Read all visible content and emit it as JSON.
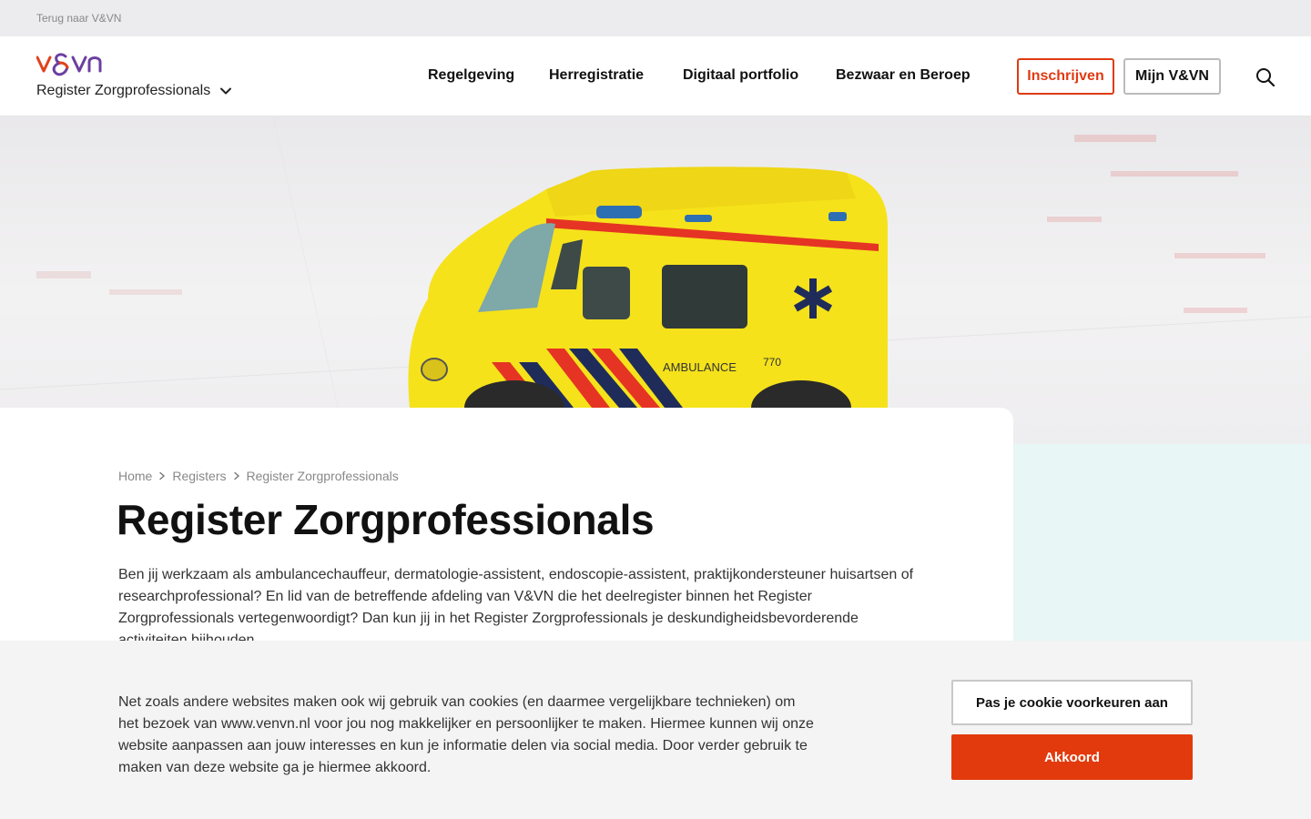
{
  "topbar": {
    "back_link": "Terug naar V&VN"
  },
  "header": {
    "logo": {
      "alt": "v&vn",
      "colors": {
        "v": "#e0421a",
        "ampersand": "#6b3fa0",
        "vn": "#6b3fa0"
      }
    },
    "site_selector": {
      "label": "Register Zorgprofessionals",
      "icon": "chevron-down-icon"
    },
    "nav": [
      {
        "label": "Regelgeving"
      },
      {
        "label": "Herregistratie"
      },
      {
        "label": "Digitaal portfolio"
      },
      {
        "label": "Bezwaar en Beroep"
      }
    ],
    "signup_label": "Inschrijven",
    "account_label": "Mijn V&VN",
    "search_icon": "search-icon"
  },
  "hero": {
    "image": "yellow toy ambulance",
    "vehicle_text": "AMBULANCE",
    "vehicle_number": "770"
  },
  "breadcrumb": [
    {
      "label": "Home"
    },
    {
      "label": "Registers"
    },
    {
      "label": "Register Zorgprofessionals"
    }
  ],
  "page": {
    "title": "Register Zorgprofessionals",
    "intro": "Ben jij werkzaam als ambulancechauffeur, dermatologie-assistent, endoscopie-assistent, praktijkondersteuner huisartsen of researchprofessional? En lid van de betreffende afdeling van V&VN die het deelregister binnen het Register Zorgprofessionals vertegenwoordigt? Dan kun jij in het Register Zorgprofessionals je deskundigheidsbevorderende activiteiten bijhouden."
  },
  "cookie": {
    "text": "Net zoals andere websites maken ook wij gebruik van cookies (en daarmee vergelijkbare technieken) om het bezoek van www.venvn.nl voor jou nog makkelijker en persoonlijker te maken. Hiermee kunnen wij onze website aanpassen aan jouw interesses en kun je informatie delen via social media. Door verder gebruik te maken van deze website ga je hiermee akkoord.",
    "preferences_label": "Pas je cookie voorkeuren aan",
    "accept_label": "Akkoord"
  },
  "colors": {
    "accent": "#e33a0d",
    "teal_panel": "#e8f6f5",
    "ambulance_yellow": "#f5e21b"
  }
}
